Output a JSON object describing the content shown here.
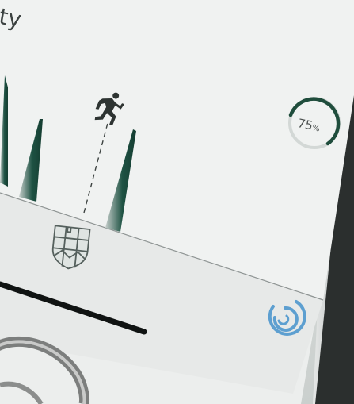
{
  "card": {
    "title_fragment": "ty"
  },
  "activity_chart": {
    "marker_icon": "running-person-icon"
  },
  "progress_ring": {
    "value": 75,
    "value_text": "75",
    "unit": "%",
    "color": "#1f4d3c"
  },
  "bottom_bar": {
    "shield_icon": "city-crest-icon",
    "sync_icon": "sync-ring-icon",
    "accent": "#5d9fd0"
  },
  "colors": {
    "peak_fill": "#1e5243",
    "peak_tint": "#c9d1ce",
    "screen_bg": "#eef0ef"
  }
}
